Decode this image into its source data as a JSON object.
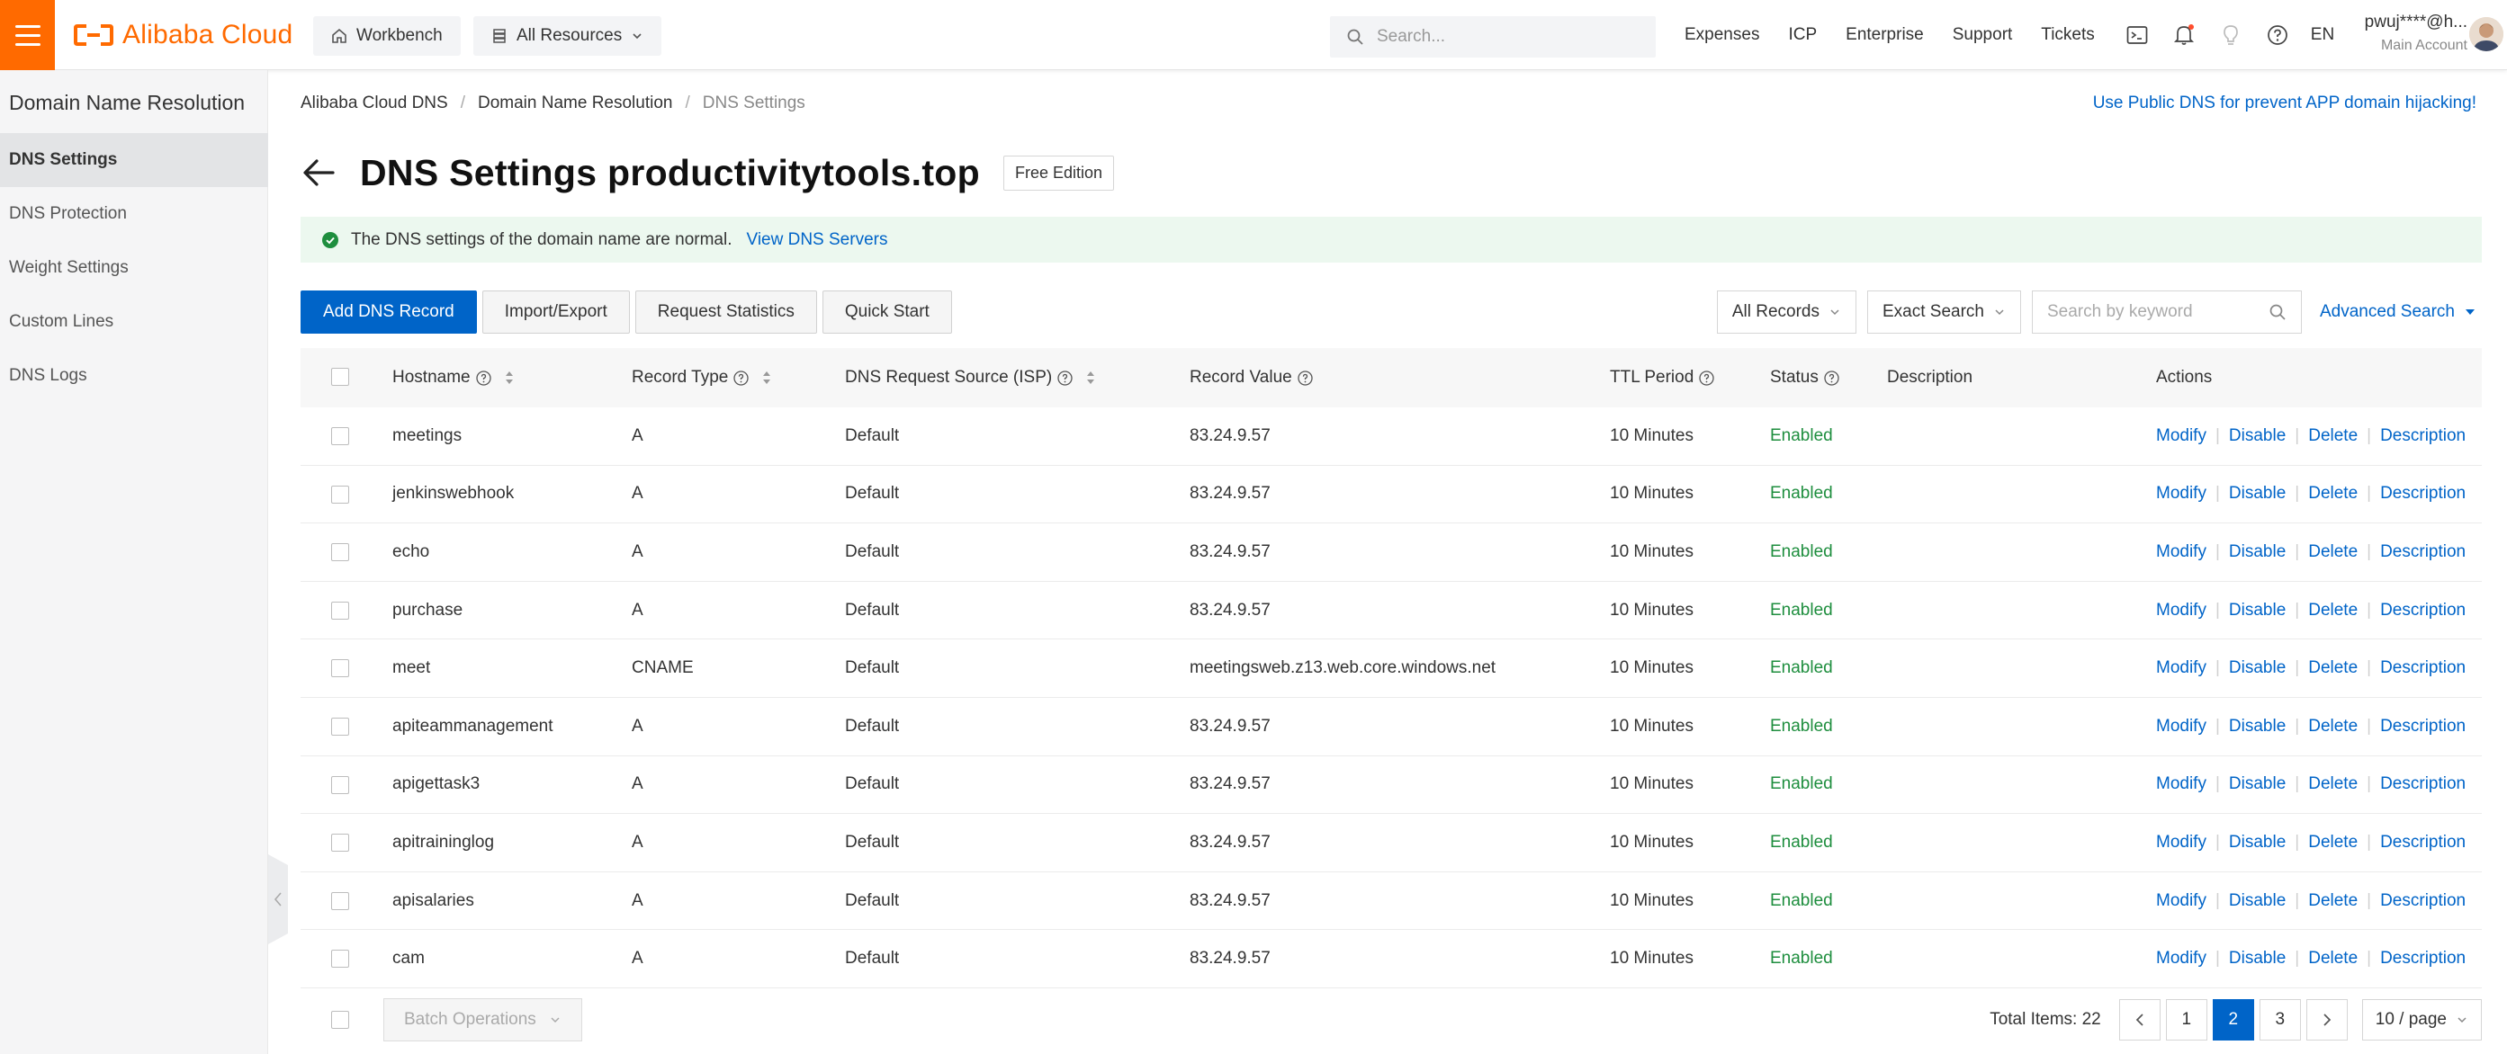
{
  "header": {
    "brand": "Alibaba Cloud",
    "workbench": "Workbench",
    "all_resources": "All Resources",
    "search_placeholder": "Search...",
    "links": [
      "Expenses",
      "ICP",
      "Enterprise",
      "Support",
      "Tickets"
    ],
    "lang": "EN",
    "user_name": "pwuj****@h...",
    "user_role": "Main Account",
    "accent": "#ff6a00"
  },
  "sidebar": {
    "title": "Domain Name Resolution",
    "items": [
      {
        "label": "DNS Settings",
        "active": true
      },
      {
        "label": "DNS Protection"
      },
      {
        "label": "Weight Settings"
      },
      {
        "label": "Custom Lines"
      },
      {
        "label": "DNS Logs"
      }
    ]
  },
  "breadcrumb": [
    "Alibaba Cloud DNS",
    "Domain Name Resolution",
    "DNS Settings"
  ],
  "promo": "Use Public DNS for prevent APP domain hijacking!",
  "page": {
    "title": "DNS Settings productivitytools.top",
    "edition": "Free Edition"
  },
  "notice": {
    "text": "The DNS settings of the domain name are normal.",
    "link": "View DNS Servers"
  },
  "toolbar": {
    "add": "Add DNS Record",
    "import_export": "Import/Export",
    "request_stats": "Request Statistics",
    "quick_start": "Quick Start"
  },
  "filters": {
    "records": "All Records",
    "exact": "Exact Search",
    "keyword_placeholder": "Search by keyword",
    "advanced": "Advanced Search"
  },
  "table": {
    "columns": {
      "hostname": "Hostname",
      "record_type": "Record Type",
      "source": "DNS Request Source (ISP)",
      "value": "Record Value",
      "ttl": "TTL Period",
      "status": "Status",
      "description": "Description",
      "actions": "Actions"
    },
    "action_labels": [
      "Modify",
      "Disable",
      "Delete",
      "Description"
    ],
    "rows": [
      {
        "hostname": "meetings",
        "type": "A",
        "source": "Default",
        "value": "83.24.9.57",
        "ttl": "10 Minutes",
        "status": "Enabled"
      },
      {
        "hostname": "jenkinswebhook",
        "type": "A",
        "source": "Default",
        "value": "83.24.9.57",
        "ttl": "10 Minutes",
        "status": "Enabled"
      },
      {
        "hostname": "echo",
        "type": "A",
        "source": "Default",
        "value": "83.24.9.57",
        "ttl": "10 Minutes",
        "status": "Enabled"
      },
      {
        "hostname": "purchase",
        "type": "A",
        "source": "Default",
        "value": "83.24.9.57",
        "ttl": "10 Minutes",
        "status": "Enabled"
      },
      {
        "hostname": "meet",
        "type": "CNAME",
        "source": "Default",
        "value": "meetingsweb.z13.web.core.windows.net",
        "ttl": "10 Minutes",
        "status": "Enabled"
      },
      {
        "hostname": "apiteammanagement",
        "type": "A",
        "source": "Default",
        "value": "83.24.9.57",
        "ttl": "10 Minutes",
        "status": "Enabled"
      },
      {
        "hostname": "apigettask3",
        "type": "A",
        "source": "Default",
        "value": "83.24.9.57",
        "ttl": "10 Minutes",
        "status": "Enabled"
      },
      {
        "hostname": "apitraininglog",
        "type": "A",
        "source": "Default",
        "value": "83.24.9.57",
        "ttl": "10 Minutes",
        "status": "Enabled"
      },
      {
        "hostname": "apisalaries",
        "type": "A",
        "source": "Default",
        "value": "83.24.9.57",
        "ttl": "10 Minutes",
        "status": "Enabled"
      },
      {
        "hostname": "cam",
        "type": "A",
        "source": "Default",
        "value": "83.24.9.57",
        "ttl": "10 Minutes",
        "status": "Enabled"
      }
    ]
  },
  "footer": {
    "batch": "Batch Operations",
    "total": "Total Items: 22",
    "pages": [
      "1",
      "2",
      "3"
    ],
    "current_page": "2",
    "per_page": "10 / page"
  }
}
